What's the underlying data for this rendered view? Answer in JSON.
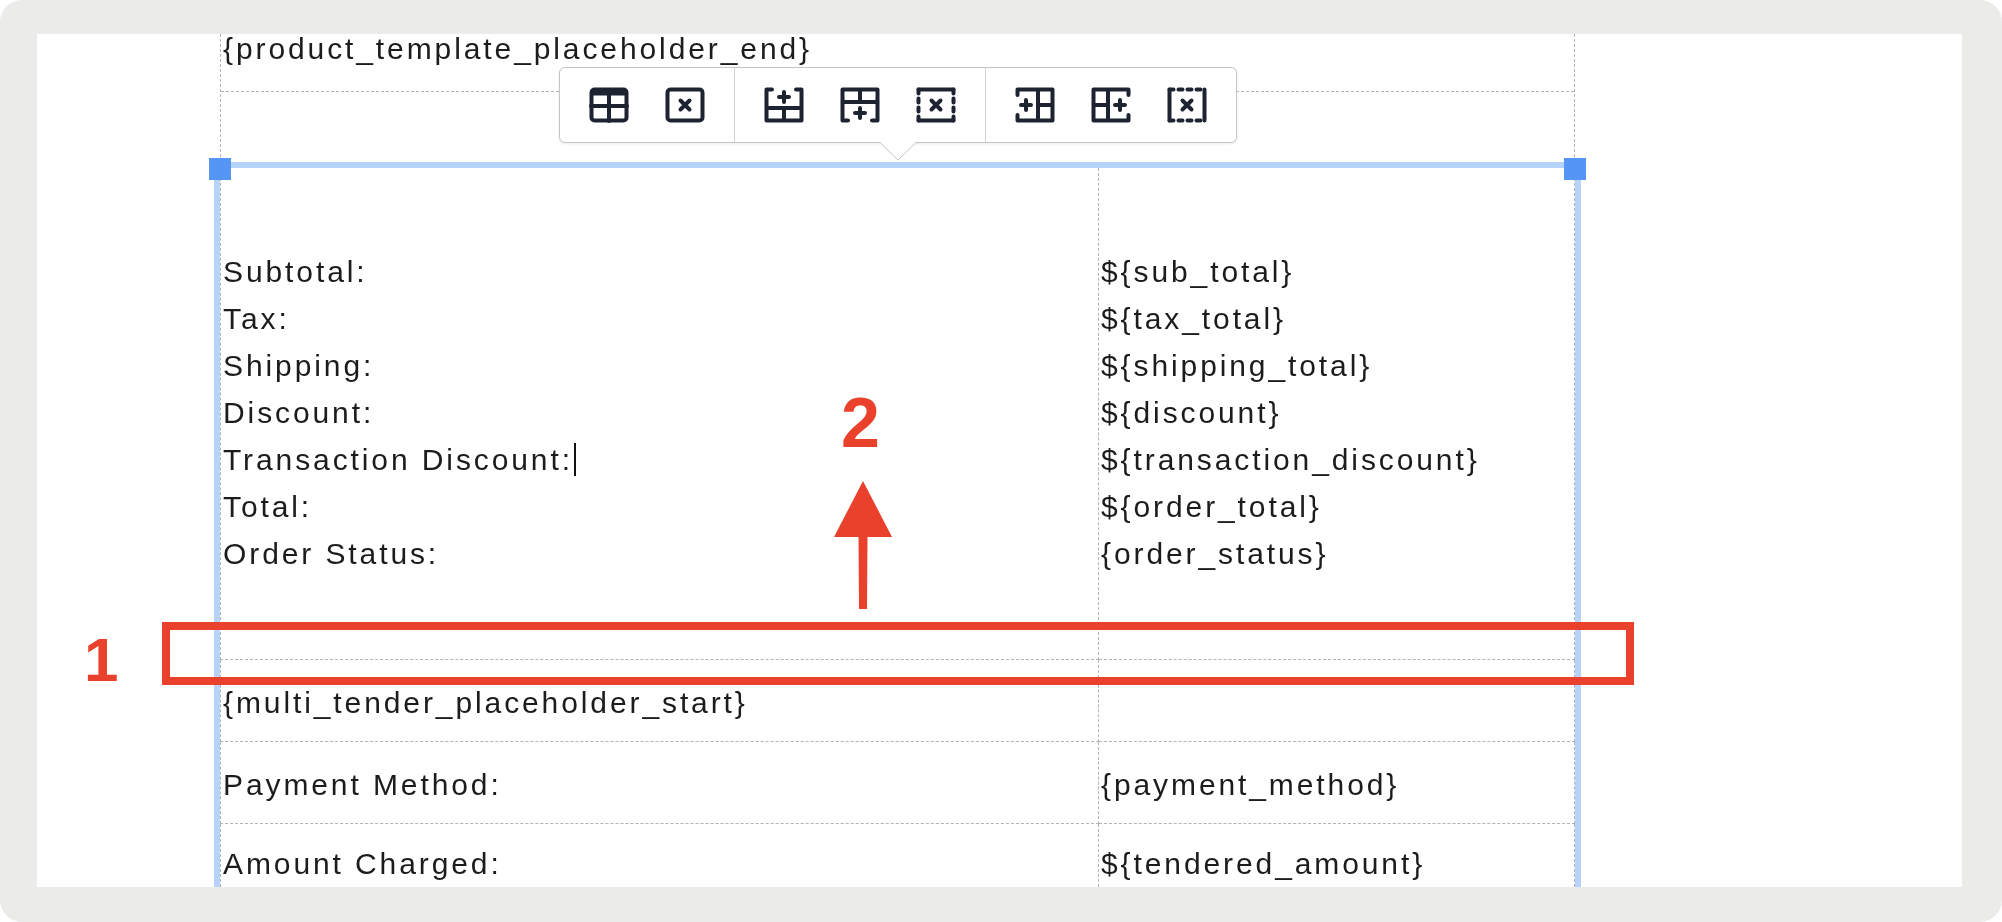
{
  "template_table": {
    "text": "{product_template_placeholder_end}"
  },
  "summary_table": {
    "selected": true,
    "totals": [
      {
        "label": "Subtotal:",
        "value": "${sub_total}",
        "caret": false
      },
      {
        "label": "Tax:",
        "value": "${tax_total}",
        "caret": false
      },
      {
        "label": "Shipping:",
        "value": "${shipping_total}",
        "caret": false
      },
      {
        "label": "Discount:",
        "value": "${discount}",
        "caret": false
      },
      {
        "label": "Transaction Discount:",
        "value": "${transaction_discount}",
        "caret": true
      },
      {
        "label": "Total:",
        "value": "${order_total}",
        "caret": false
      },
      {
        "label": "Order Status:",
        "value": "{order_status}",
        "caret": false
      }
    ],
    "rows": [
      {
        "label": "{multi_tender_placeholder_start}"
      },
      {
        "label": "Payment Method:",
        "value": "{payment_method}"
      },
      {
        "label": "Amount Charged:",
        "value": "${tendered_amount}"
      }
    ]
  },
  "annotations": [
    {
      "kind": "box",
      "label": "1"
    },
    {
      "kind": "arrow",
      "label": "2"
    }
  ]
}
